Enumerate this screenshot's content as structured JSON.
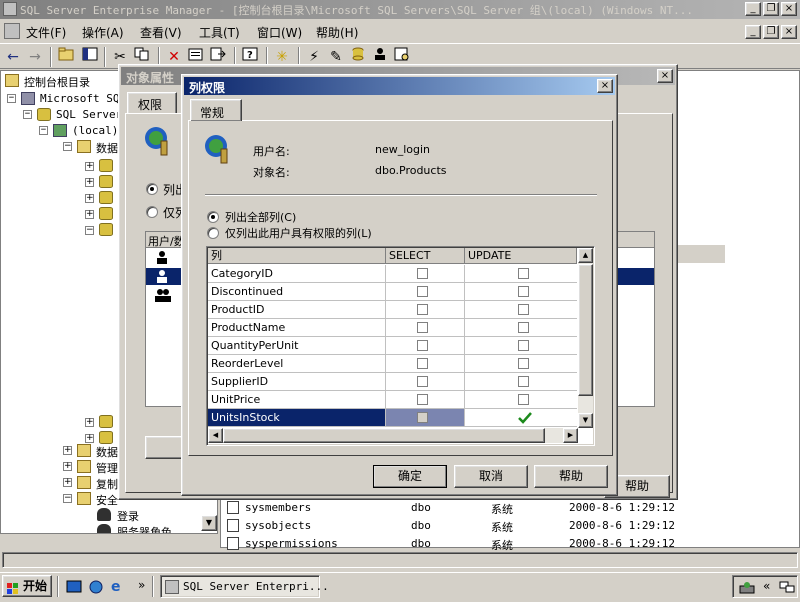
{
  "main_window": {
    "title": "SQL Server Enterprise Manager - [控制台根目录\\Microsoft SQL Servers\\SQL Server 组\\(local) (Windows NT...",
    "minimize_label": "_",
    "restore_label": "❐",
    "close_label": "×"
  },
  "menu": {
    "items": [
      "文件(F)",
      "操作(A)",
      "查看(V)",
      "工具(T)",
      "窗口(W)",
      "帮助(H)"
    ]
  },
  "tree": {
    "root": "控制台根目录",
    "ms_sql": "Microsoft SQL",
    "group": "SQL Server",
    "local": "(local)",
    "databases": "数据",
    "node_b": "数据",
    "node_manage": "管理",
    "node_repl": "复制",
    "node_security": "安全",
    "node_logins": "登录",
    "node_roles": "服务器角色"
  },
  "list": {
    "rows": [
      {
        "name": "sysmembers",
        "owner": "dbo",
        "type": "系统",
        "created": "2000-8-6 1:29:12"
      },
      {
        "name": "sysobjects",
        "owner": "dbo",
        "type": "系统",
        "created": "2000-8-6 1:29:12"
      },
      {
        "name": "syspermissions",
        "owner": "dbo",
        "type": "系统",
        "created": "2000-8-6 1:29:12"
      }
    ]
  },
  "obj_dialog": {
    "title": "对象属性",
    "tab": "权限",
    "radio_list_all": "列出",
    "radio_list_only": "仅列",
    "col_header": "用户/数",
    "help_label": "帮助"
  },
  "col_dialog": {
    "title": "列权限",
    "close_label": "×",
    "tab_general": "常规",
    "user_label": "用户名:",
    "user_value": "new_login",
    "object_label": "对象名:",
    "object_value": "dbo.Products",
    "radio_all": "列出全部列(C)",
    "radio_permitted": "仅列出此用户具有权限的列(L)",
    "grid_headers": [
      "列",
      "SELECT",
      "UPDATE"
    ],
    "rows": [
      {
        "name": "CategoryID",
        "select": false,
        "update": false
      },
      {
        "name": "Discontinued",
        "select": false,
        "update": false
      },
      {
        "name": "ProductID",
        "select": false,
        "update": false
      },
      {
        "name": "ProductName",
        "select": false,
        "update": false
      },
      {
        "name": "QuantityPerUnit",
        "select": false,
        "update": false
      },
      {
        "name": "ReorderLevel",
        "select": false,
        "update": false
      },
      {
        "name": "SupplierID",
        "select": false,
        "update": false
      },
      {
        "name": "UnitPrice",
        "select": false,
        "update": false
      },
      {
        "name": "UnitsInStock",
        "select": false,
        "update": true
      }
    ],
    "selected_row": "UnitsInStock",
    "ok_label": "确定",
    "cancel_label": "取消",
    "help_label": "帮助"
  },
  "taskbar": {
    "start_label": "开始",
    "task_label": "SQL Server Enterpri...",
    "chevron": "»",
    "tray_chevron": "«"
  },
  "colors": {
    "active_title": "#0a246a",
    "inactive_title": "#808080",
    "face": "#d4d0c8",
    "selection": "#0a246a",
    "check_green": "#1c8a1c"
  }
}
